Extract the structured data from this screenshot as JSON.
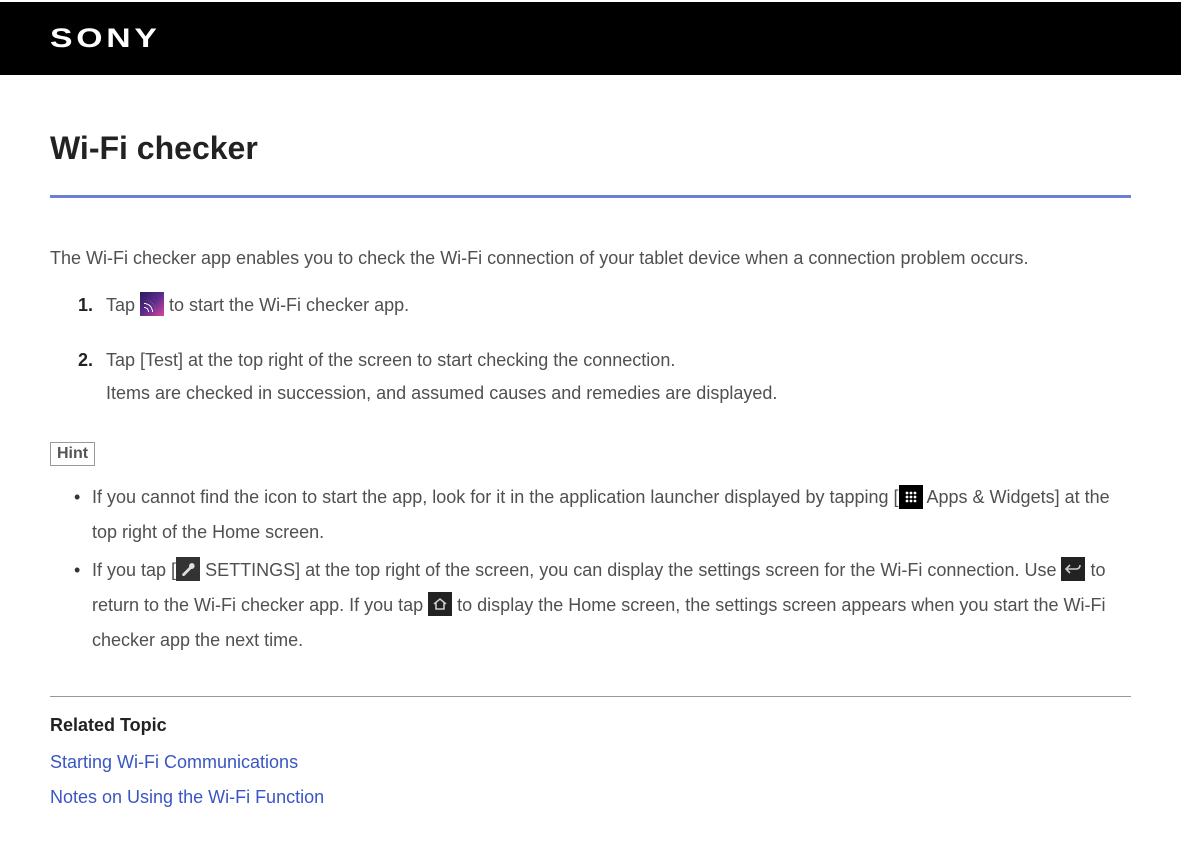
{
  "header": {
    "logo_text": "SONY"
  },
  "page": {
    "title": "Wi-Fi checker",
    "intro": "The Wi-Fi checker app enables you to check the Wi-Fi connection of your tablet device when a connection problem occurs."
  },
  "steps": [
    {
      "number": "1.",
      "pre": "Tap ",
      "icon": "wifi-checker-icon",
      "post": " to start the Wi-Fi checker app."
    },
    {
      "number": "2.",
      "line1": "Tap [Test] at the top right of the screen to start checking the connection.",
      "line2": "Items are checked in succession, and assumed causes and remedies are displayed."
    }
  ],
  "hint": {
    "label": "Hint",
    "items": [
      {
        "pre": "If you cannot find the icon to start the app, look for it in the application launcher displayed by tapping [",
        "icon1": "apps-icon",
        "post": " Apps & Widgets] at the top right of the Home screen."
      },
      {
        "pre": "If you tap [",
        "icon1": "settings-icon",
        "mid1": " SETTINGS] at the top right of the screen, you can display the settings screen for the Wi-Fi connection. Use ",
        "icon2": "back-icon",
        "mid2": " to return to the Wi-Fi checker app. If you tap ",
        "icon3": "home-icon",
        "post": " to display the Home screen, the settings screen appears when you start the Wi-Fi checker app the next time."
      }
    ]
  },
  "related": {
    "heading": "Related Topic",
    "links": [
      "Starting Wi-Fi Communications",
      "Notes on Using the Wi-Fi Function"
    ]
  }
}
